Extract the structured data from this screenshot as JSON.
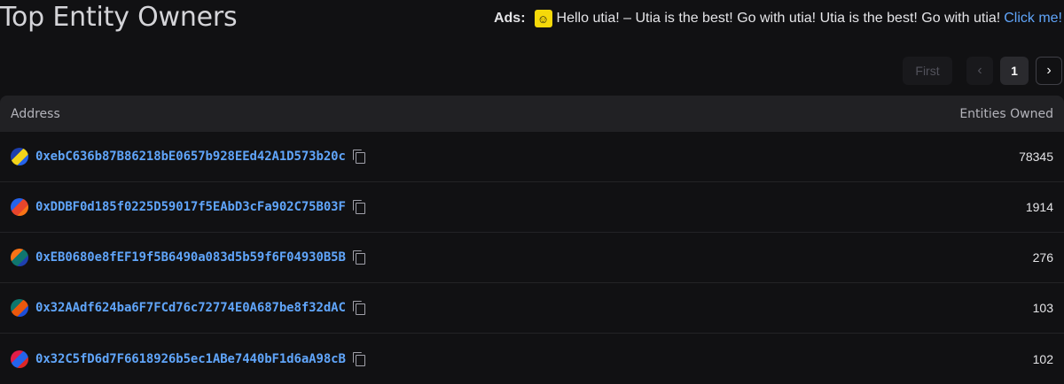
{
  "page": {
    "title": "Top Entity Owners"
  },
  "ads": {
    "label": "Ads:",
    "icon": "utia-icon",
    "text": "Hello utia! – Utia is the best! Go with utia! Utia is the best! Go with utia!",
    "link": "Click me!"
  },
  "pagination": {
    "first_label": "First",
    "prev_icon": "chevron-left-icon",
    "current_page": "1",
    "next_icon": "chevron-right-icon"
  },
  "table": {
    "columns": {
      "address": "Address",
      "entities_owned": "Entities Owned"
    },
    "rows": [
      {
        "address": "0xebC636b87B86218bE0657b928EEd42A1D573b20c",
        "entities_owned": "78345",
        "avatar_colors": [
          "#1d3fae",
          "#f2d31b",
          "#2563eb"
        ]
      },
      {
        "address": "0xDDBF0d185f0225D59017f5EAbD3cFa902C75B03F",
        "entities_owned": "1914",
        "avatar_colors": [
          "#2563eb",
          "#e8452c",
          "#f97316"
        ]
      },
      {
        "address": "0xEB0680e8fEF19f5B6490a083d5b59f6F04930B5B",
        "entities_owned": "276",
        "avatar_colors": [
          "#f97316",
          "#0f766e",
          "#1e40af"
        ]
      },
      {
        "address": "0x32AAdf624ba6F7FCd76c72774E0A687be8f32dAC",
        "entities_owned": "103",
        "avatar_colors": [
          "#0f766e",
          "#ea580c",
          "#1d4ed8"
        ]
      },
      {
        "address": "0x32C5fD6d7F6618926b5ec1ABe7440bF1d6aA98cB",
        "entities_owned": "102",
        "avatar_colors": [
          "#e11d48",
          "#2563eb",
          "#dc2626"
        ]
      }
    ]
  }
}
